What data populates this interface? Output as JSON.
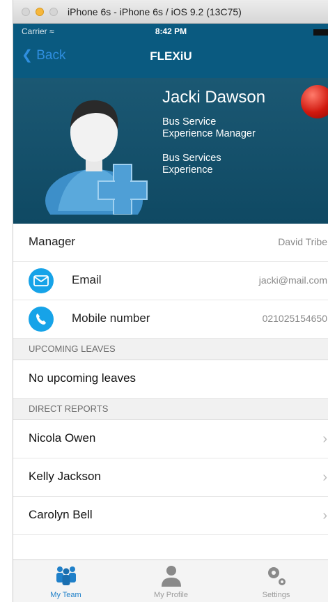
{
  "window": {
    "title": "iPhone 6s - iPhone 6s / iOS 9.2 (13C75)"
  },
  "status_bar": {
    "carrier": "Carrier",
    "time": "8:42 PM"
  },
  "nav": {
    "back_label": "Back",
    "title": "FLEXiU"
  },
  "profile": {
    "name": "Jacki Dawson",
    "role_line1": "Bus Service",
    "role_line2": "Experience Manager",
    "dept_line1": "Bus Services",
    "dept_line2": "Experience",
    "status_color": "#d0180e"
  },
  "details": {
    "manager_label": "Manager",
    "manager_value": "David Tribe",
    "email_label": "Email",
    "email_value": "jacki@mail.com",
    "mobile_label": "Mobile number",
    "mobile_value": "021025154650"
  },
  "sections": {
    "upcoming_leaves": "UPCOMING LEAVES",
    "no_leaves": "No upcoming leaves",
    "direct_reports": "DIRECT REPORTS"
  },
  "reports": [
    {
      "name": "Nicola Owen"
    },
    {
      "name": "Kelly Jackson"
    },
    {
      "name": "Carolyn Bell"
    }
  ],
  "tabs": [
    {
      "label": "My Team",
      "icon": "team-icon"
    },
    {
      "label": "My Profile",
      "icon": "profile-icon"
    },
    {
      "label": "Settings",
      "icon": "gears-icon"
    }
  ],
  "colors": {
    "nav_bg": "#0a5a80",
    "accent": "#16a3e8",
    "back": "#2f8fe0",
    "active_tab": "#1f80c9"
  }
}
